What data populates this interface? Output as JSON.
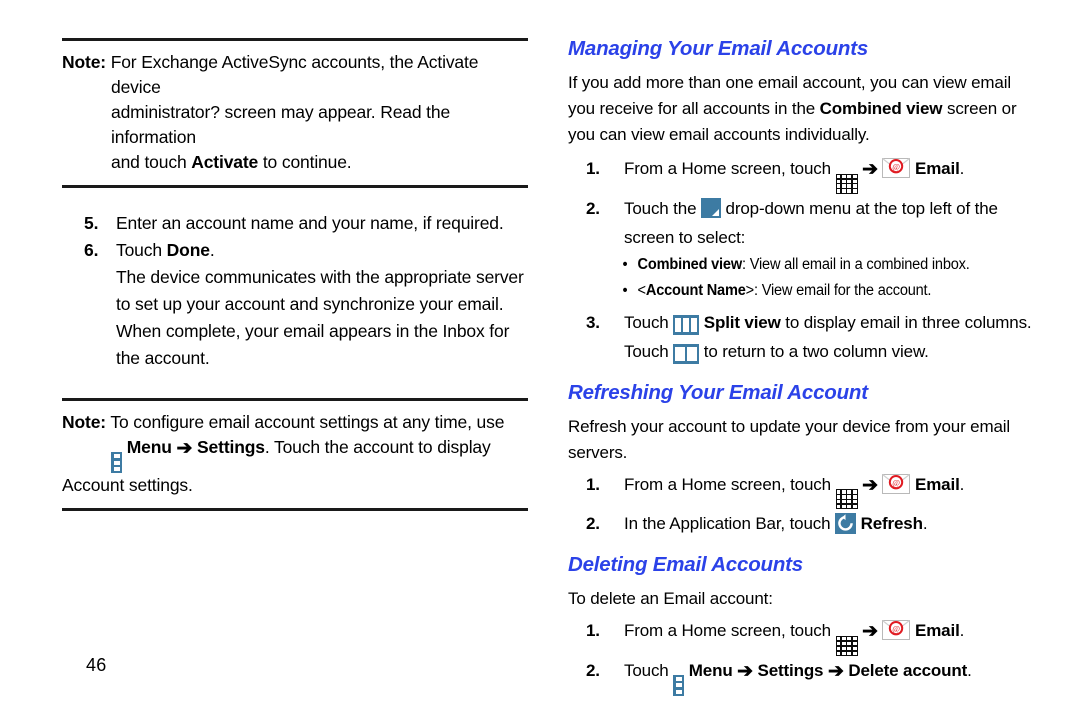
{
  "page": {
    "number": "46"
  },
  "left_column": {
    "note1": {
      "label": "Note:",
      "line1": "For Exchange ActiveSync accounts, the Activate device",
      "line2": "administrator? screen may appear. Read the information",
      "line3_pre": "and touch ",
      "line3_bold": "Activate",
      "line3_post": " to continue."
    },
    "steps": [
      {
        "num": "5.",
        "text": "Enter an account name and your name, if required."
      },
      {
        "num": "6.",
        "pre": "Touch ",
        "bold": "Done",
        "post": "."
      }
    ],
    "step6_body": [
      "The device communicates with the appropriate server",
      "to set up your account and synchronize your email.",
      "When complete, your email appears in the Inbox for",
      "the account."
    ],
    "note2": {
      "label": "Note:",
      "line1": "To configure email account settings at any time, use",
      "menu_icon": "menu-icon",
      "menu_label": "Menu",
      "arrow": "➔",
      "settings_label": "Settings",
      "line2_post": ". Touch the account to display",
      "line3": "Account settings."
    }
  },
  "right_column": {
    "section1": {
      "title": "Managing Your Email Accounts",
      "intro_line1": "If you add more than one email account, you can view email",
      "intro_line2_pre": "you receive for all accounts in the ",
      "intro_line2_bold": "Combined view",
      "intro_line2_post": " screen or",
      "intro_line3": "you can view email accounts individually.",
      "step1": {
        "num": "1.",
        "pre": "From a Home screen, touch ",
        "apps_icon": "apps-grid-icon",
        "arrow": "➔",
        "email_icon": "email-envelope-icon",
        "email_label": "Email",
        "post": "."
      },
      "step2": {
        "num": "2.",
        "pre": "Touch the ",
        "dropdown_icon": "dropdown-square-icon",
        "mid": " drop-down menu at the top left of the",
        "line2": "screen to select:"
      },
      "bullets": [
        {
          "bold": "Combined view",
          "rest": ": View all email in a combined inbox."
        },
        {
          "bold_pre": "<",
          "bold": "Account Name",
          "bold_post": ">",
          "rest": ": View email for the account."
        }
      ],
      "step3": {
        "num": "3.",
        "pre": "Touch ",
        "split3_icon": "split-view-three-column-icon",
        "bold": "Split view",
        "post": " to display email in three columns.",
        "line2_pre": "Touch ",
        "split2_icon": "split-view-two-column-icon",
        "line2_post": " to return to a two column view."
      }
    },
    "section2": {
      "title": "Refreshing Your Email Account",
      "intro_line1": "Refresh your account to update your device from your email",
      "intro_line2": "servers.",
      "step1": {
        "num": "1.",
        "pre": "From a Home screen, touch ",
        "apps_icon": "apps-grid-icon",
        "arrow": "➔",
        "email_icon": "email-envelope-icon",
        "email_label": "Email",
        "post": "."
      },
      "step2": {
        "num": "2.",
        "pre": "In the Application Bar, touch ",
        "refresh_icon": "refresh-icon",
        "bold": "Refresh",
        "post": "."
      }
    },
    "section3": {
      "title": "Deleting Email Accounts",
      "intro": "To delete an Email account:",
      "step1": {
        "num": "1.",
        "pre": "From a Home screen, touch ",
        "apps_icon": "apps-grid-icon",
        "arrow": "➔",
        "email_icon": "email-envelope-icon",
        "email_label": "Email",
        "post": "."
      },
      "step2": {
        "num": "2.",
        "pre": "Touch ",
        "menu_icon": "menu-icon",
        "menu_label": "Menu",
        "arrow1": "➔",
        "settings_label": "Settings",
        "arrow2": "➔",
        "delete_label": "Delete account",
        "post": "."
      }
    }
  },
  "colors": {
    "heading_blue": "#2b42e8",
    "icon_blue": "#3d7ba3",
    "rule_black": "#1a1a1a",
    "email_red": "#e01b22"
  }
}
